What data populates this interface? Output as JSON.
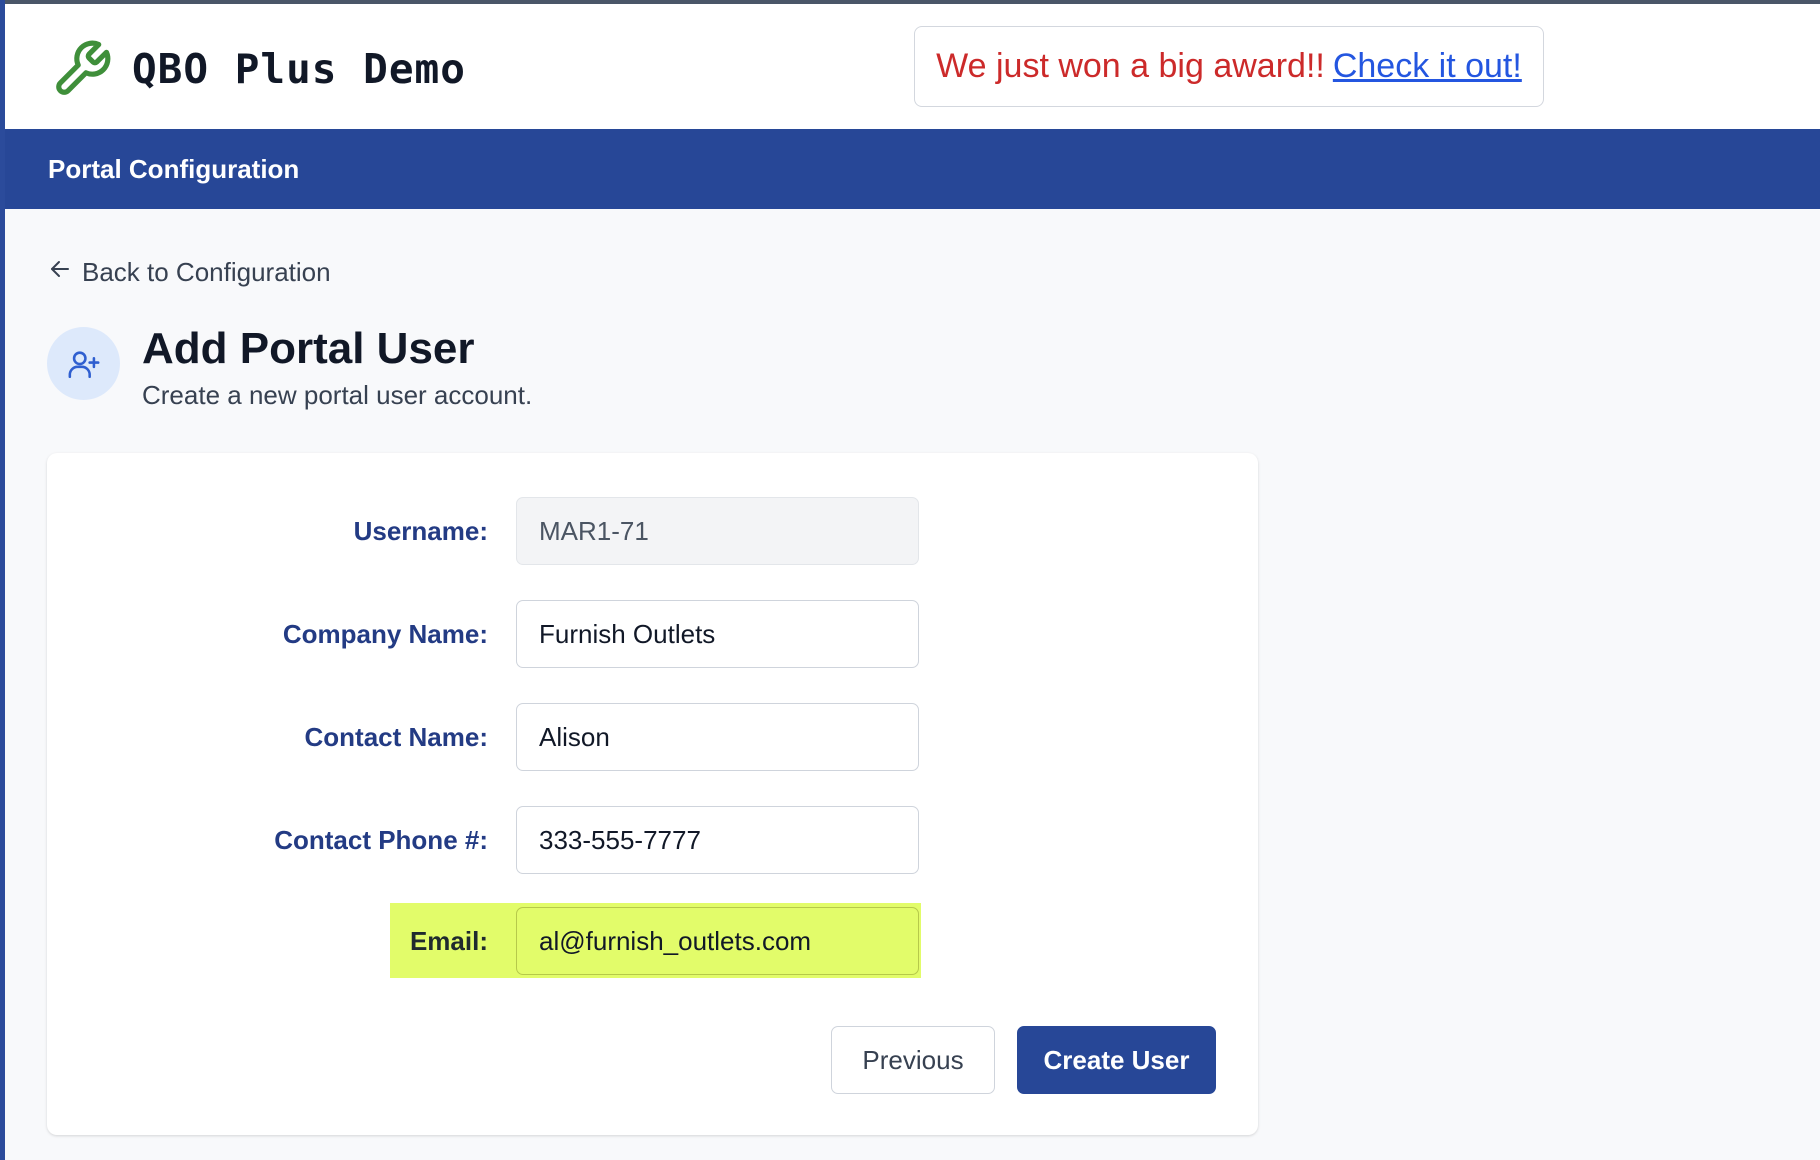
{
  "header": {
    "app_title": "QBO Plus Demo",
    "brand_icon": "wrench-icon",
    "brand_color": "#3f8f3a",
    "announcement": {
      "text": "We just won a big award!!",
      "link_label": "Check it out!",
      "text_color": "#cc2a2a",
      "link_color": "#2456e0"
    }
  },
  "nav": {
    "title": "Portal Configuration",
    "background": "#274797"
  },
  "back_link": {
    "icon": "arrow-left-icon",
    "label": "Back to Configuration"
  },
  "page": {
    "icon": "user-plus-icon",
    "title": "Add Portal User",
    "subtitle": "Create a new portal user account."
  },
  "form": {
    "fields": [
      {
        "label": "Username:",
        "value": "MAR1-71",
        "readonly": true
      },
      {
        "label": "Company Name:",
        "value": "Furnish Outlets",
        "readonly": false
      },
      {
        "label": "Contact Name:",
        "value": "Alison",
        "readonly": false
      },
      {
        "label": "Contact Phone #:",
        "value": "333-555-7777",
        "readonly": false
      },
      {
        "label": "Email:",
        "value": "al@furnish_outlets.com",
        "readonly": false,
        "highlighted": true
      }
    ],
    "highlight_color": "#e2fc6a",
    "previous_label": "Previous",
    "submit_label": "Create User"
  }
}
